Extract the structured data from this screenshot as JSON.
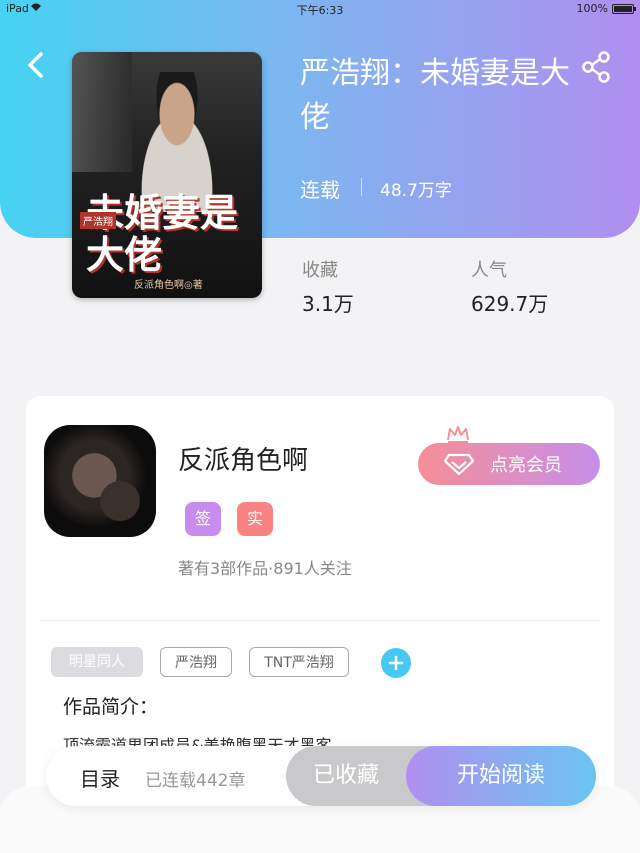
{
  "status_bar": {
    "device": "iPad",
    "time": "下午6:33",
    "battery": "100%"
  },
  "header": {
    "back_icon": "chevron-left-icon",
    "share_icon": "share-icon"
  },
  "book": {
    "cover": {
      "series_tag": "严浩翔",
      "title": "未婚妻是大佬",
      "author": "反派角色啊◎著"
    },
    "title": "严浩翔：未婚妻是大佬",
    "status": "连载",
    "word_count": "48.7万字",
    "stats": [
      {
        "label": "收藏",
        "value": "3.1万"
      },
      {
        "label": "人气",
        "value": "629.7万"
      }
    ]
  },
  "author": {
    "name": "反派角色啊",
    "badges": [
      "签",
      "实"
    ],
    "summary": "著有3部作品·891人关注",
    "vip_button": "点亮会员"
  },
  "tags": [
    "明星同人",
    "严浩翔",
    "TNT严浩翔"
  ],
  "intro": {
    "heading": "作品简介：",
    "text": "顶流霸道男团成员&美艳腹黑天才黑客"
  },
  "bottom_bar": {
    "toc_label": "目录",
    "chapter_count": "已连载442章",
    "collected_label": "已收藏",
    "read_label": "开始阅读"
  },
  "colors": {
    "gradient_start": "#45d2f2",
    "gradient_end": "#b08ff0",
    "sign_badge": "#c88cf0",
    "real_badge": "#f98282",
    "add_button": "#45c9f2"
  }
}
